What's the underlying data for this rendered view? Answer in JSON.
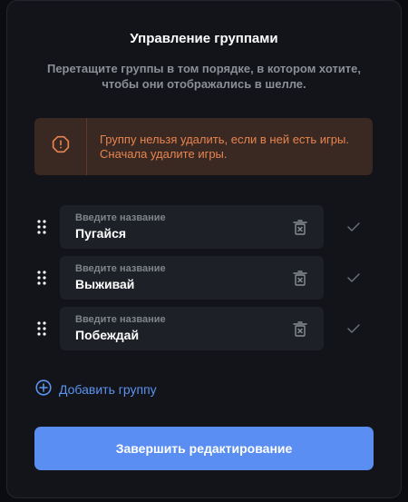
{
  "dialog": {
    "title": "Управление группами",
    "subtitle": "Перетащите группы в том порядке, в котором хотите, чтобы они отображались в шелле."
  },
  "warning": {
    "icon": "octagon-alert-icon",
    "text": "Группу нельзя удалить, если в ней есть игры. Сначала удалите игры.",
    "color": "#e8854f",
    "background": "#3a2822"
  },
  "groups": [
    {
      "placeholder": "Введите название",
      "value": "Пугайся"
    },
    {
      "placeholder": "Введите название",
      "value": "Выживай"
    },
    {
      "placeholder": "Введите название",
      "value": "Побеждай"
    }
  ],
  "add_group": {
    "label": "Добавить группу",
    "icon": "plus-circle-icon"
  },
  "finish_button": {
    "label": "Завершить редактирование",
    "color": "#5a8ef2"
  },
  "accent": "#5b93f0"
}
